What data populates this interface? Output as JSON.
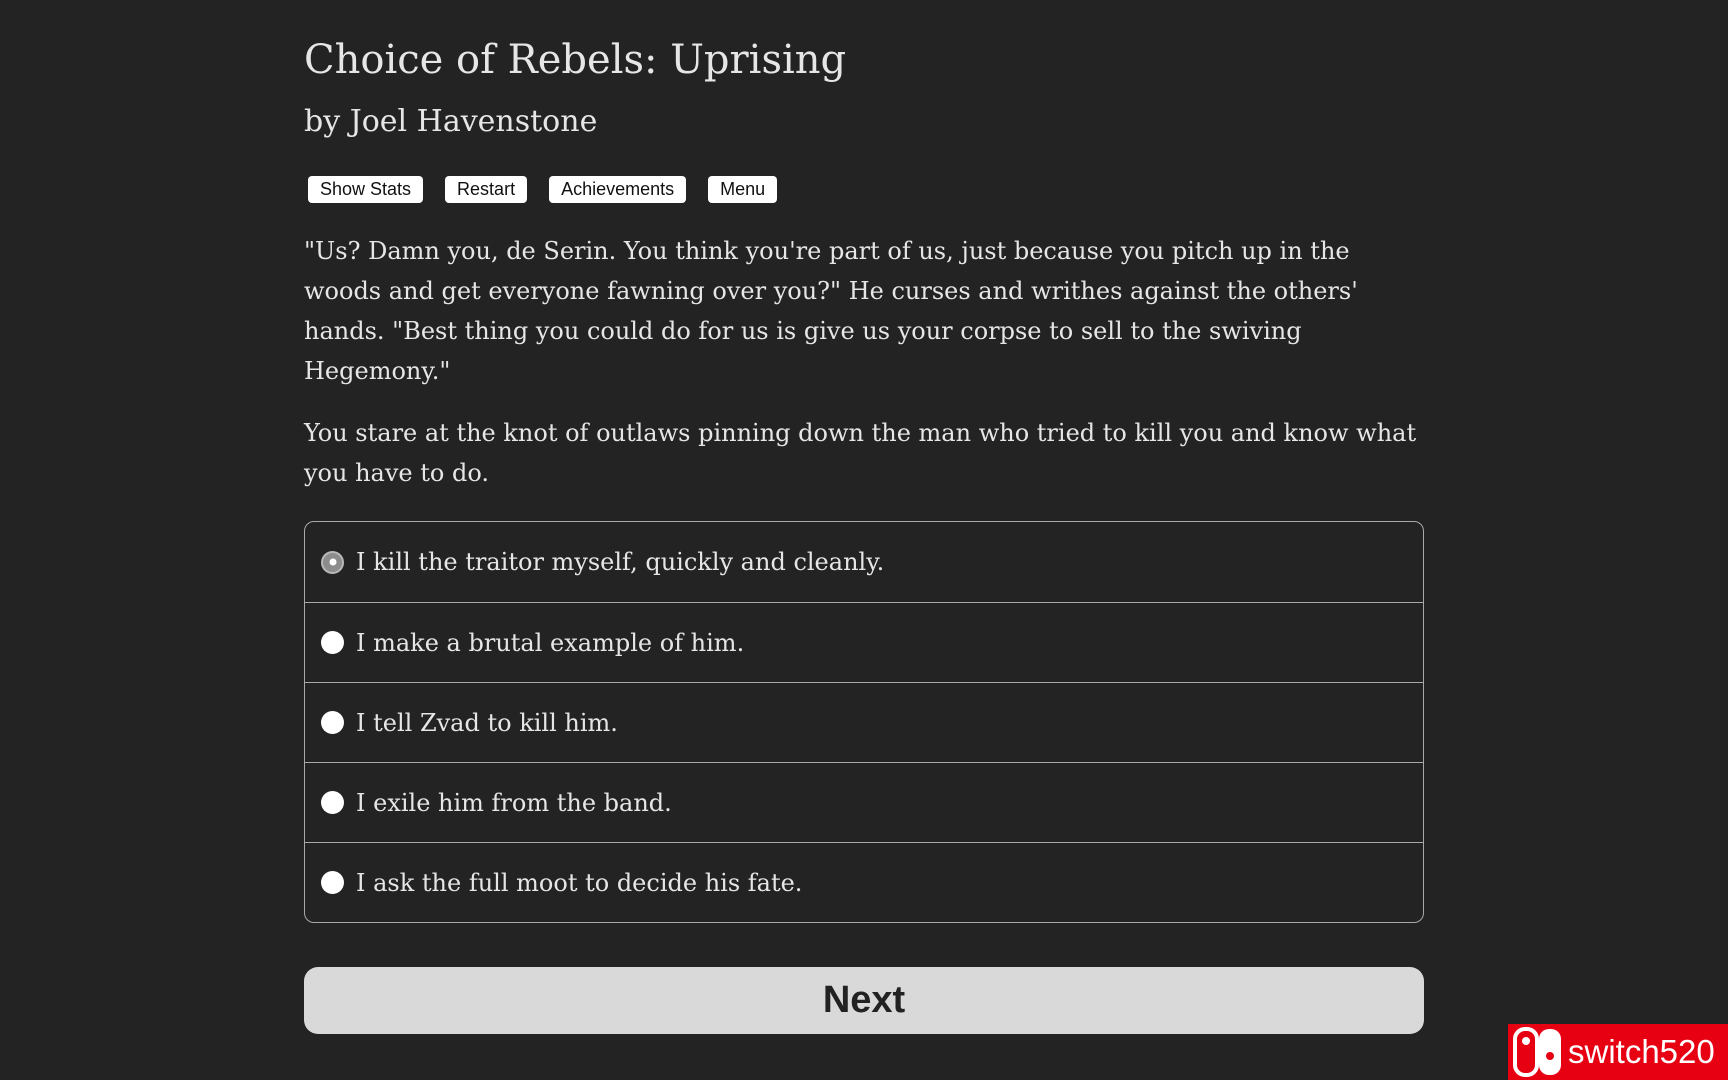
{
  "game": {
    "title": "Choice of Rebels: Uprising",
    "author": "by Joel Havenstone"
  },
  "toolbar": {
    "show_stats": "Show Stats",
    "restart": "Restart",
    "achievements": "Achievements",
    "menu": "Menu"
  },
  "story": {
    "paragraphs": [
      "\"Us? Damn you, de Serin. You think you're part of us, just because you pitch up in the woods and get everyone fawning over you?\" He curses and writhes against the others' hands. \"Best thing you could do for us is give us your corpse to sell to the swiving Hegemony.\"",
      "You stare at the knot of outlaws pinning down the man who tried to kill you and know what you have to do."
    ]
  },
  "choices": [
    {
      "label": "I kill the traitor myself, quickly and cleanly.",
      "selected": true
    },
    {
      "label": "I make a brutal example of him.",
      "selected": false
    },
    {
      "label": "I tell Zvad to kill him.",
      "selected": false
    },
    {
      "label": "I exile him from the band.",
      "selected": false
    },
    {
      "label": "I ask the full moot to decide his fate.",
      "selected": false
    }
  ],
  "next_button": "Next",
  "watermark": {
    "text": "switch520",
    "icon": "switch-console-icon",
    "color": "#e60012"
  },
  "colors": {
    "background": "#232323",
    "text": "#e6e6e6",
    "next_button_bg": "#d9d9d9"
  }
}
